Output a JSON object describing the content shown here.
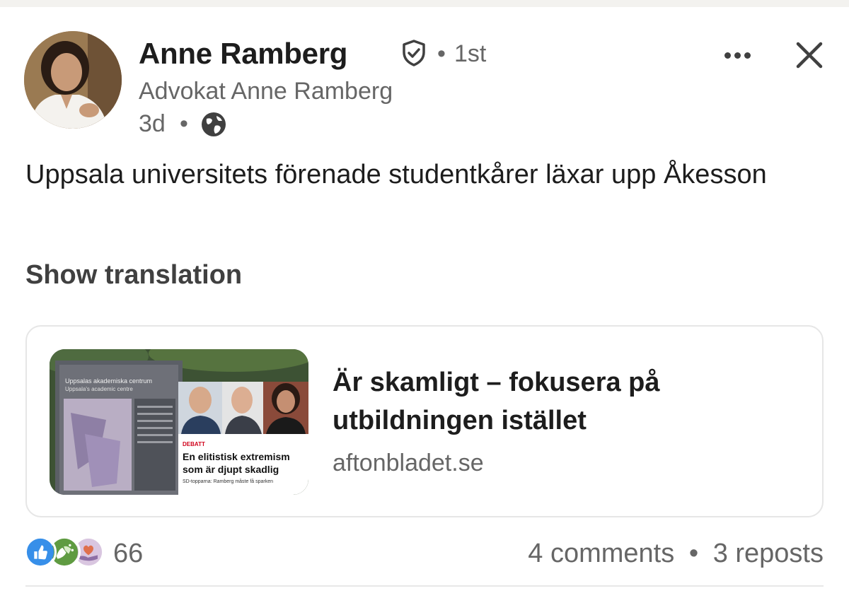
{
  "post": {
    "author": {
      "name": "Anne Ramberg",
      "connection_degree": "1st",
      "headline": "Advokat Anne Ramberg",
      "time_ago": "3d",
      "visibility_icon": "globe-icon",
      "verified_icon": "verified-shield-icon"
    },
    "text": "Uppsala universitets förenade studentkårer läxar upp Åkesson",
    "show_translation_label": "Show translation",
    "link_preview": {
      "title": "Är skamligt – fokusera på utbildningen istället",
      "domain": "aftonbladet.se",
      "thumbnail": {
        "sign_title": "Uppsalas akademiska centrum",
        "sign_subtitle": "Uppsala's academic centre",
        "tag": "DEBATT",
        "headline_line1": "En elitistisk extremism",
        "headline_line2": "som är djupt skadlig",
        "caption": "SD-topparna: Ramberg måste få sparken"
      }
    },
    "reactions": {
      "icons": [
        "like-icon",
        "celebrate-icon",
        "love-icon"
      ],
      "count": "66"
    },
    "comments_label": "4 comments",
    "separator": "•",
    "reposts_label": "3 reposts"
  },
  "colors": {
    "text_primary": "#1d1d1d",
    "text_secondary": "#666666",
    "like_blue": "#378fe9",
    "celebrate_green": "#5f9b41",
    "love_pink": "#df704d"
  }
}
